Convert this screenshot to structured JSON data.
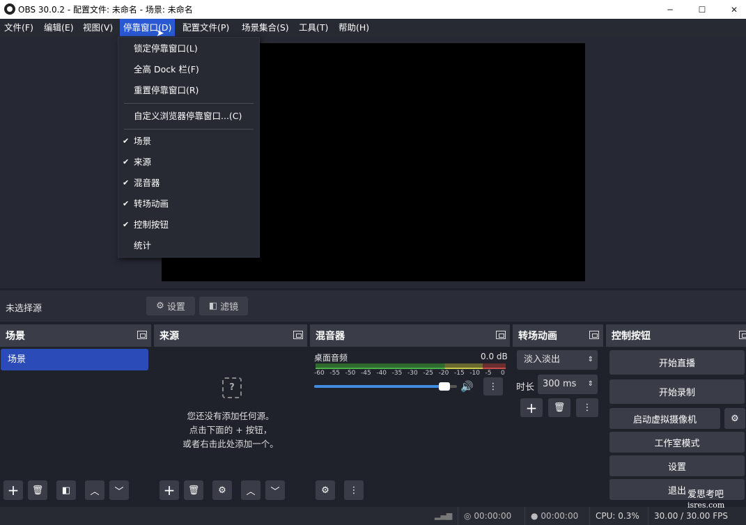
{
  "window": {
    "title": "OBS 30.0.2 - 配置文件: 未命名 - 场景: 未命名",
    "minimize": "─",
    "maximize": "☐",
    "close": "✕"
  },
  "menubar": [
    "文件(F)",
    "编辑(E)",
    "视图(V)",
    "停靠窗口(D)",
    "配置文件(P)",
    "场景集合(S)",
    "工具(T)",
    "帮助(H)"
  ],
  "dock_menu": {
    "items": [
      "锁定停靠窗口(L)",
      "全高 Dock 栏(F)",
      "重置停靠窗口(R)",
      "自定义浏览器停靠窗口...(C)",
      "场景",
      "来源",
      "混音器",
      "转场动画",
      "控制按钮",
      "统计"
    ],
    "checked": [
      false,
      false,
      false,
      false,
      true,
      true,
      true,
      true,
      true,
      false
    ],
    "check_glyph": "✔"
  },
  "source_bar": {
    "label": "未选择源",
    "settings": "设置",
    "filters": "滤镜"
  },
  "scenes": {
    "title": "场景",
    "items": [
      "场景"
    ]
  },
  "sources": {
    "title": "来源",
    "empty_lines": [
      "您还没有添加任何源。",
      "点击下面的 + 按钮，",
      "或者右击此处添加一个。"
    ]
  },
  "mixer": {
    "title": "混音器",
    "channel": "桌面音频",
    "level": "0.0 dB",
    "scale": [
      "-60",
      "-55",
      "-50",
      "-45",
      "-40",
      "-35",
      "-30",
      "-25",
      "-20",
      "-15",
      "-10",
      "-5",
      "0"
    ],
    "volume": 0.95
  },
  "transitions": {
    "title": "转场动画",
    "type": "淡入淡出",
    "duration_label": "时长",
    "duration": "300 ms"
  },
  "controls": {
    "title": "控制按钮",
    "start_stream": "开始直播",
    "start_record": "开始录制",
    "virtual_cam": "启动虚拟摄像机",
    "studio_mode": "工作室模式",
    "settings": "设置",
    "exit": "退出"
  },
  "status": {
    "stream_time": "00:00:00",
    "record_time": "00:00:00",
    "cpu": "CPU: 0.3%",
    "fps": "30.00 / 30.00 FPS"
  },
  "watermark": {
    "line1": "爱思考吧",
    "line2": "isres.com"
  },
  "colors": {
    "accent": "#2b59d3",
    "panel": "#2a2d38",
    "bg": "#1f212b"
  }
}
